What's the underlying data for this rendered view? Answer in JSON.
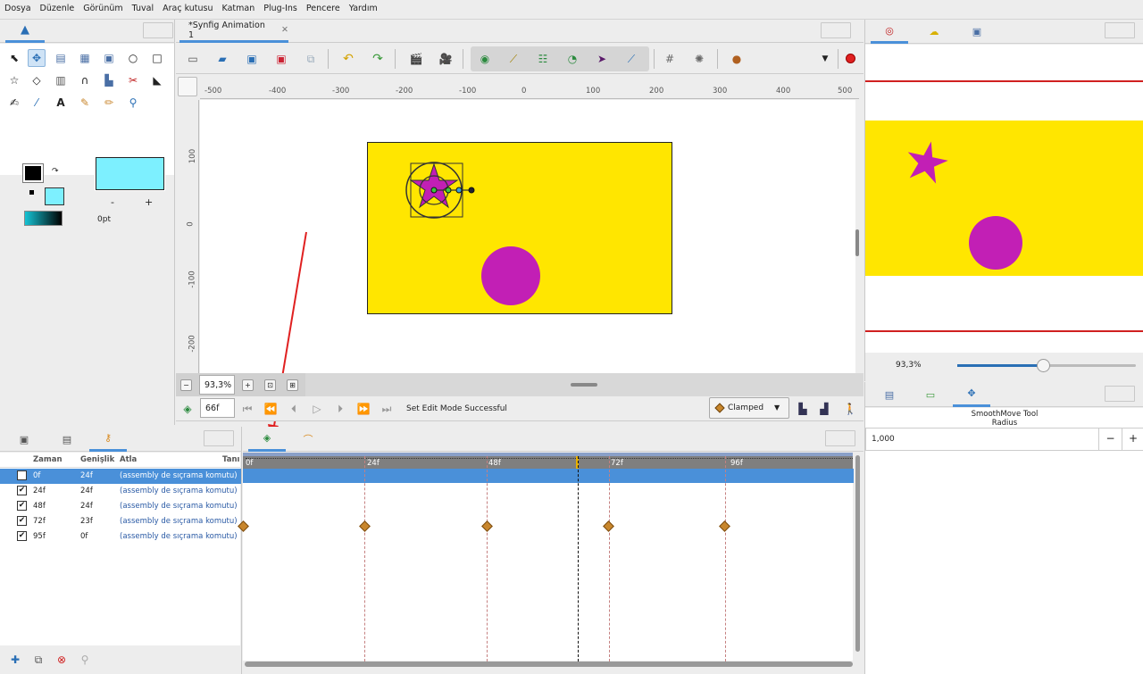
{
  "menu": [
    "Dosya",
    "Düzenle",
    "Görünüm",
    "Tuval",
    "Araç kutusu",
    "Katman",
    "Plug-Ins",
    "Pencere",
    "Yardım"
  ],
  "document_tab": {
    "title": "*Synfig Animation 1"
  },
  "ruler": {
    "h_labels": [
      "-500",
      "-400",
      "-300",
      "-200",
      "-100",
      "0",
      "100",
      "200",
      "300",
      "400",
      "500"
    ],
    "v_labels": [
      "100",
      "0",
      "-100",
      "-200"
    ]
  },
  "canvas_bottom": {
    "zoom": "93,3%",
    "frame": "66f",
    "status": "Set Edit Mode Successful",
    "interpolation": "Clamped"
  },
  "toolbox": {
    "width_value": "0pt",
    "minus": "-",
    "plus": "+"
  },
  "navigator": {
    "zoom": "93,3%"
  },
  "tool_options": {
    "title": "SmoothMove Tool",
    "param_label": "Radius",
    "radius_value": "1,000",
    "minus": "−",
    "plus": "+"
  },
  "keyframes": {
    "headers": [
      "Zaman",
      "Genişlik",
      "Atla",
      "Tanı"
    ],
    "rows": [
      {
        "time": "0f",
        "length": "24f",
        "jump": "(assembly de sıçrama komutu)"
      },
      {
        "time": "24f",
        "length": "24f",
        "jump": "(assembly de sıçrama komutu)"
      },
      {
        "time": "48f",
        "length": "24f",
        "jump": "(assembly de sıçrama komutu)"
      },
      {
        "time": "72f",
        "length": "23f",
        "jump": "(assembly de sıçrama komutu)"
      },
      {
        "time": "95f",
        "length": "0f",
        "jump": "(assembly de sıçrama komutu)"
      }
    ]
  },
  "timetrack": {
    "labels": [
      "0f",
      "24f",
      "48f",
      "72f",
      "96f"
    ]
  },
  "colors": {
    "canvas_bg": "#ffe600",
    "shape": "#c21fb5",
    "accent": "#4a90d9",
    "red_arrow": "#e02020",
    "outline_fill": "#7df0ff"
  }
}
